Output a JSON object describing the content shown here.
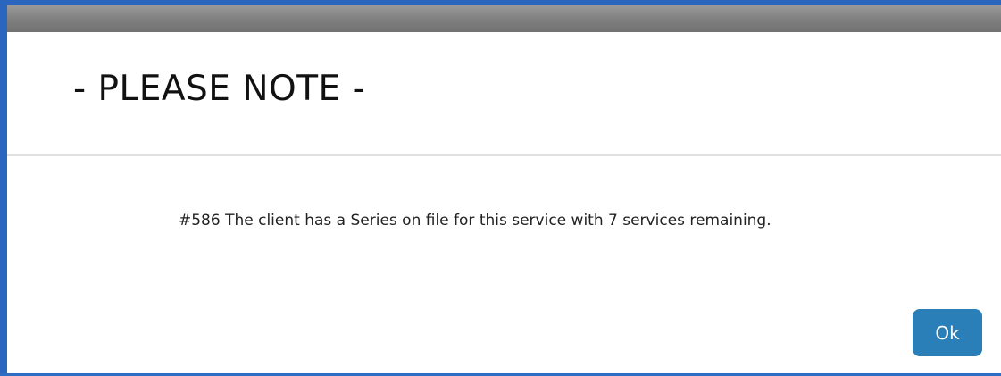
{
  "dialog": {
    "title": "- PLEASE NOTE -",
    "message": "#586 The client has a Series on file for this service with 7 services remaining.",
    "ok_label": "Ok"
  },
  "colors": {
    "frame": "#2d6dc4",
    "titlebar": "#7e7e7e",
    "ok_button": "#2a7fb8",
    "divider": "#e1e1e1"
  }
}
